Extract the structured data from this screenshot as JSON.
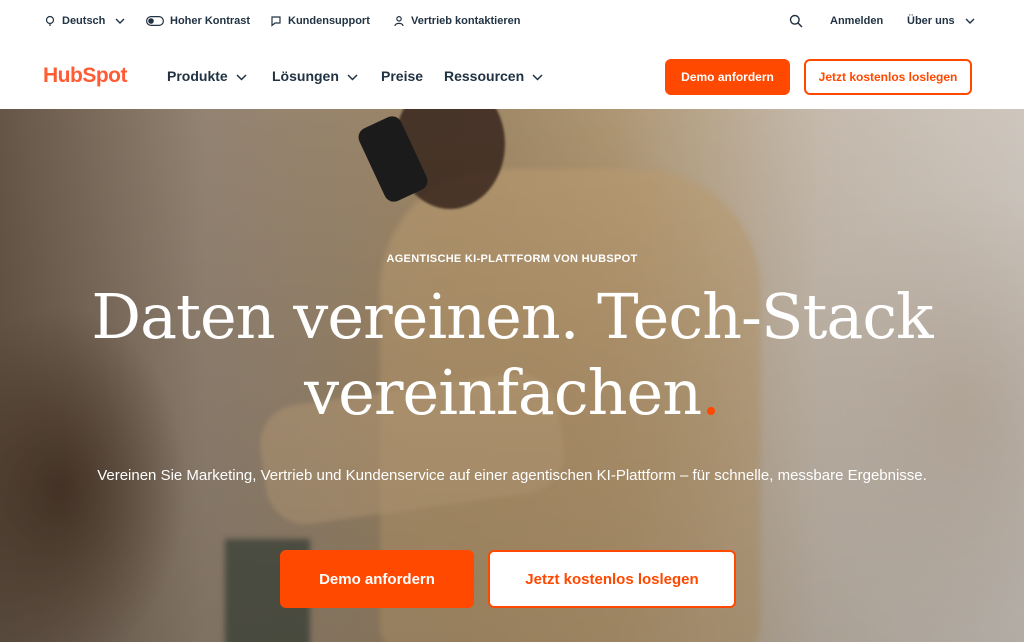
{
  "utility": {
    "language": "Deutsch",
    "contrast": "Hoher Kontrast",
    "support": "Kundensupport",
    "sales": "Vertrieb kontaktieren",
    "login": "Anmelden",
    "about": "Über uns"
  },
  "nav": {
    "logo": "HubSpot",
    "items": [
      "Produkte",
      "Lösungen",
      "Preise",
      "Ressourcen"
    ],
    "demo_button": "Demo anfordern",
    "free_button": "Jetzt kostenlos loslegen"
  },
  "hero": {
    "eyebrow": "AGENTISCHE KI-PLATTFORM VON HUBSPOT",
    "title_line1": "Daten vereinen. Tech-Stack",
    "title_line2": "vereinfachen",
    "title_dot": ".",
    "subtitle": "Vereinen Sie Marketing, Vertrieb und Kundenservice auf einer agentischen KI-Plattform – für schnelle, messbare Ergebnisse.",
    "demo_button": "Demo anfordern",
    "free_button": "Jetzt kostenlos loslegen"
  },
  "colors": {
    "brand": "#ff4800",
    "logo": "#ff5c35",
    "text": "#213343"
  },
  "icons": [
    "globe-icon",
    "contrast-toggle-icon",
    "chat-bubble-icon",
    "person-icon",
    "search-icon",
    "chevron-down-icon"
  ]
}
